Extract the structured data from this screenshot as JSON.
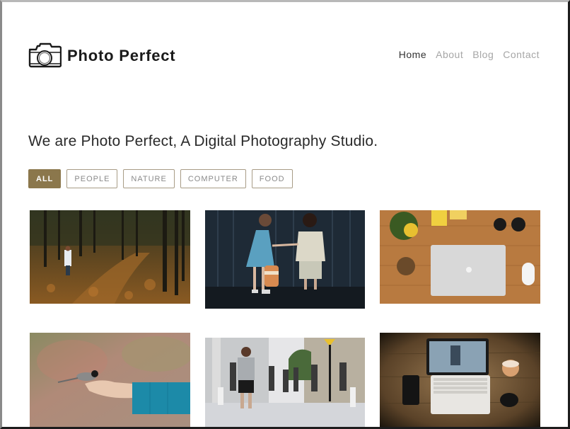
{
  "header": {
    "logo_icon": "camera-icon",
    "brand": "Photo Perfect",
    "nav": [
      {
        "label": "Home",
        "active": true
      },
      {
        "label": "About",
        "active": false
      },
      {
        "label": "Blog",
        "active": false
      },
      {
        "label": "Contact",
        "active": false
      }
    ]
  },
  "intro": {
    "headline": "We are Photo Perfect, A Digital Photography Studio."
  },
  "filters": [
    {
      "label": "ALL",
      "active": true
    },
    {
      "label": "PEOPLE",
      "active": false
    },
    {
      "label": "NATURE",
      "active": false
    },
    {
      "label": "COMPUTER",
      "active": false
    },
    {
      "label": "FOOD",
      "active": false
    }
  ],
  "gallery": [
    {
      "subject": "Child in white coat in autumn forest path",
      "category": "nature"
    },
    {
      "subject": "Two children holding hands by a dark wooden fence",
      "category": "people"
    },
    {
      "subject": "Laptop on wooden desk with plant and lenses",
      "category": "computer"
    },
    {
      "subject": "Bird perched on an outstretched hand",
      "category": "nature"
    },
    {
      "subject": "People walking on a city sidewalk",
      "category": "people"
    },
    {
      "subject": "Laptop, phone, mouse and coffee on wooden table",
      "category": "computer"
    }
  ],
  "colors": {
    "accent": "#8b774c",
    "nav_active": "#333333",
    "nav_inactive": "#a6a6a6",
    "text": "#2a2a2a"
  }
}
